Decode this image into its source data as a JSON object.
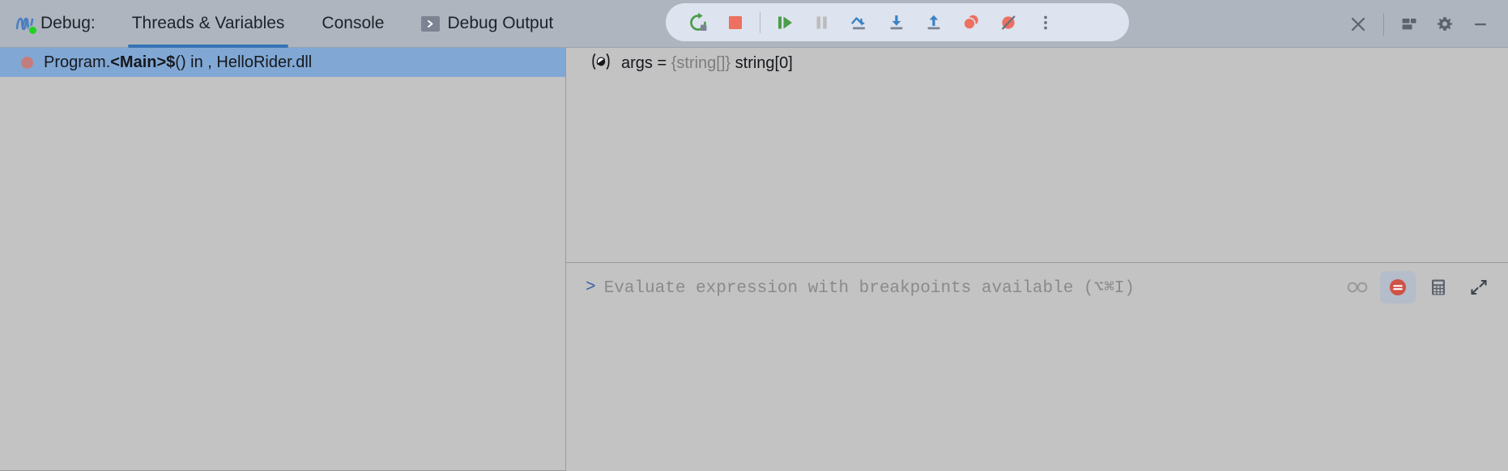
{
  "header": {
    "logo_icon": "rider-logo-icon",
    "status_dot_color": "#21d321",
    "title": "Debug:",
    "tabs": [
      {
        "label": "Threads & Variables",
        "active": true,
        "icon": null
      },
      {
        "label": "Console",
        "active": false,
        "icon": null
      },
      {
        "label": "Debug Output",
        "active": false,
        "icon": "console-chevron-icon"
      }
    ],
    "active_tab_underline_color": "#3573b5"
  },
  "toolbar": {
    "background": "#dde3ef",
    "buttons": [
      {
        "name": "rerun-button",
        "icon": "restart-icon",
        "enabled": true
      },
      {
        "name": "stop-button",
        "icon": "stop-square-icon",
        "enabled": true
      },
      {
        "name": "resume-button",
        "icon": "resume-program-icon",
        "enabled": true
      },
      {
        "name": "pause-button",
        "icon": "pause-icon",
        "enabled": false
      },
      {
        "name": "step-over-button",
        "icon": "step-over-icon",
        "enabled": true
      },
      {
        "name": "step-into-button",
        "icon": "step-into-icon",
        "enabled": true
      },
      {
        "name": "step-out-button",
        "icon": "step-out-icon",
        "enabled": true
      },
      {
        "name": "view-breakpoints-button",
        "icon": "breakpoints-icon",
        "enabled": true
      },
      {
        "name": "mute-breakpoints-button",
        "icon": "mute-breakpoints-icon",
        "enabled": true
      },
      {
        "name": "more-options-button",
        "icon": "more-vertical-icon",
        "enabled": true
      }
    ]
  },
  "window_controls": [
    {
      "name": "close-button",
      "icon": "close-icon"
    },
    {
      "name": "layout-button",
      "icon": "layout-icon"
    },
    {
      "name": "settings-button",
      "icon": "gear-icon"
    },
    {
      "name": "minimize-button",
      "icon": "minimize-icon"
    }
  ],
  "frames": {
    "selected_row_color": "#81a8d4",
    "rows": [
      {
        "icon": "breakpoint-dot-icon",
        "prefix": "Program.",
        "method": "<Main>$",
        "suffix": "() in , HelloRider.dll",
        "selected": true
      }
    ]
  },
  "variables": {
    "rows": [
      {
        "icon": "parameter-icon",
        "name": "args",
        "equals": " = ",
        "type": "{string[]}",
        "value": " string[0]"
      }
    ]
  },
  "evaluate": {
    "prompt": ">",
    "placeholder": "Evaluate expression with breakpoints available (⌥⌘I)",
    "actions": [
      {
        "name": "watches-button",
        "icon": "glasses-icon",
        "active": false
      },
      {
        "name": "mute-breakpoints-toggle",
        "icon": "mute-breakpoints-circle-icon",
        "active": true
      },
      {
        "name": "calculator-button",
        "icon": "calculator-icon",
        "active": false
      },
      {
        "name": "collapse-button",
        "icon": "collapse-arrows-icon",
        "active": false
      }
    ]
  }
}
